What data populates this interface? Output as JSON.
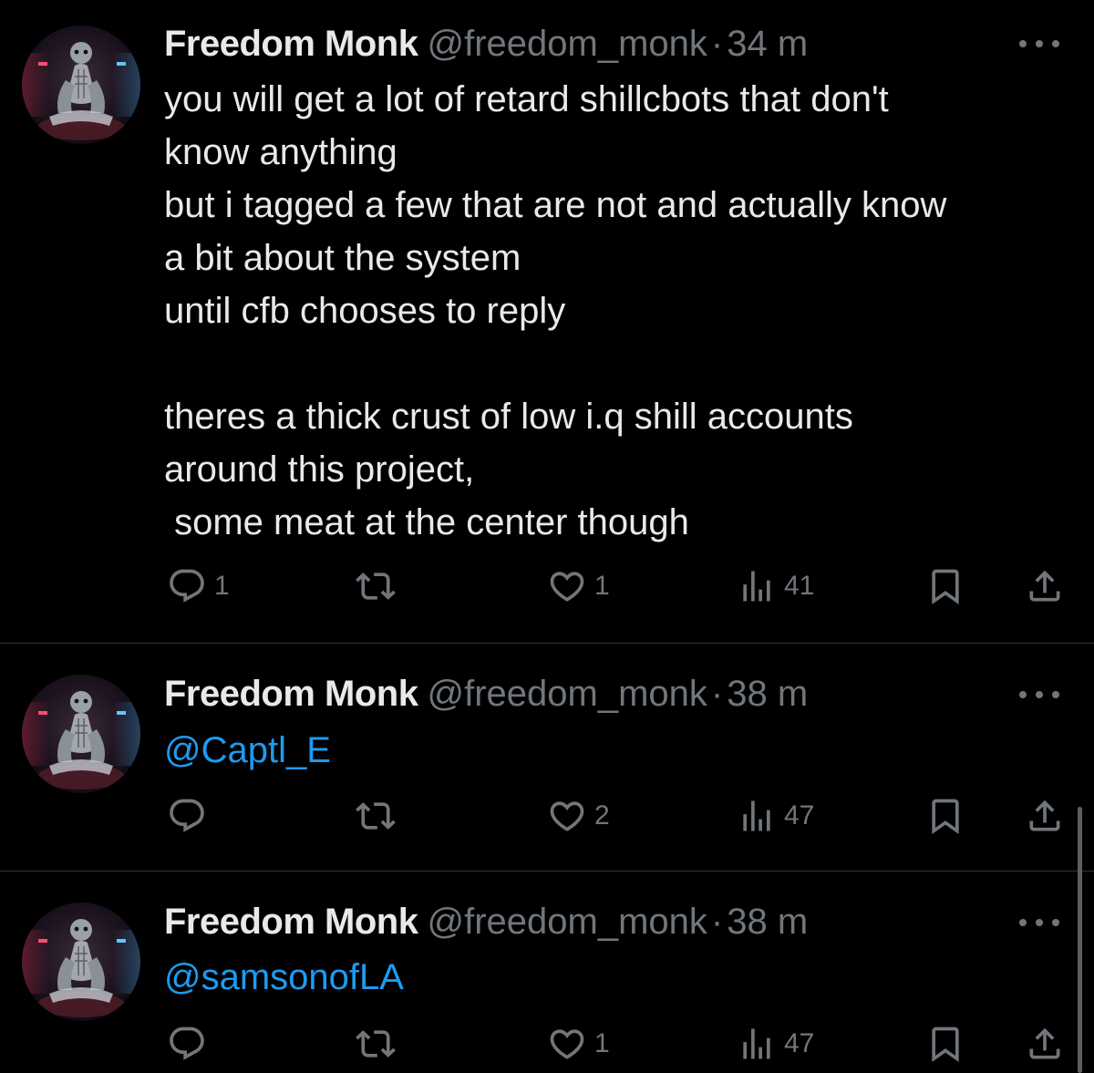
{
  "colors": {
    "background": "#000000",
    "text": "#e7e9ea",
    "muted": "#71767b",
    "link": "#1d9bf0",
    "divider": "#2f3336"
  },
  "tweets": [
    {
      "author": "Freedom Monk",
      "handle": "@freedom_monk",
      "separator": "·",
      "time": "34 m",
      "text_lines": [
        "you will get a lot of retard shillcbots that don't",
        "know anything",
        "but i tagged a few that are not and actually know",
        "a bit about the system",
        "until cfb chooses to reply",
        "",
        "theres a thick crust of low i.q shill accounts",
        "around this project,",
        " some meat at the center though"
      ],
      "replies": "1",
      "reposts": "",
      "likes": "1",
      "views": "41",
      "icons": [
        "reply-icon",
        "repost-icon",
        "like-icon",
        "views-icon",
        "bookmark-icon",
        "share-icon",
        "more-icon"
      ]
    },
    {
      "author": "Freedom Monk",
      "handle": "@freedom_monk",
      "separator": "·",
      "time": "38 m",
      "mention": "@Captl_E",
      "replies": "",
      "reposts": "",
      "likes": "2",
      "views": "47",
      "icons": [
        "reply-icon",
        "repost-icon",
        "like-icon",
        "views-icon",
        "bookmark-icon",
        "share-icon",
        "more-icon"
      ]
    },
    {
      "author": "Freedom Monk",
      "handle": "@freedom_monk",
      "separator": "·",
      "time": "38 m",
      "mention": "@samsonofLA",
      "replies": "",
      "reposts": "",
      "likes": "1",
      "views": "47",
      "icons": [
        "reply-icon",
        "repost-icon",
        "like-icon",
        "views-icon",
        "bookmark-icon",
        "share-icon",
        "more-icon"
      ]
    }
  ]
}
